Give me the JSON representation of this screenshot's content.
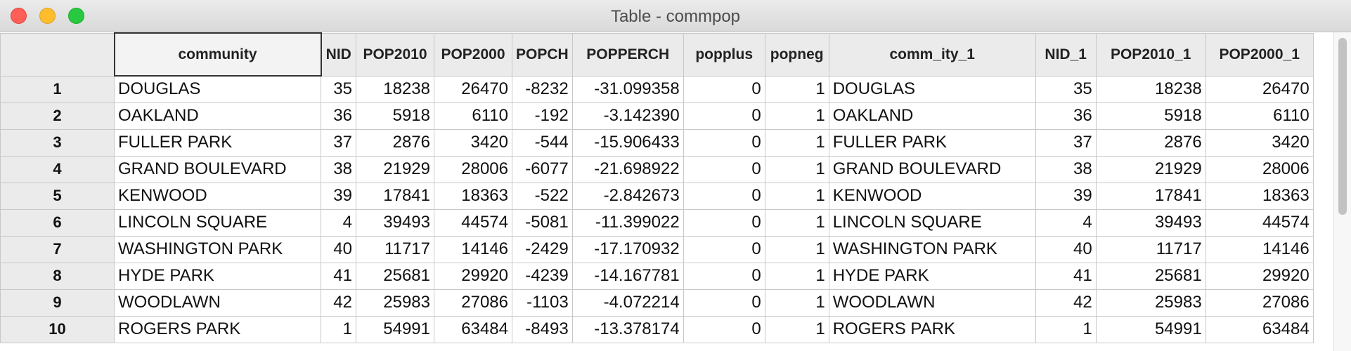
{
  "window": {
    "title": "Table - commpop"
  },
  "table": {
    "columns": [
      "",
      "community",
      "NID",
      "POP2010",
      "POP2000",
      "POPCH",
      "POPPERCH",
      "popplus",
      "popneg",
      "comm_ity_1",
      "NID_1",
      "POP2010_1",
      "POP2000_1"
    ],
    "rows": [
      [
        "1",
        "DOUGLAS",
        "35",
        "18238",
        "26470",
        "-8232",
        "-31.099358",
        "0",
        "1",
        "DOUGLAS",
        "35",
        "18238",
        "26470"
      ],
      [
        "2",
        "OAKLAND",
        "36",
        "5918",
        "6110",
        "-192",
        "-3.142390",
        "0",
        "1",
        "OAKLAND",
        "36",
        "5918",
        "6110"
      ],
      [
        "3",
        "FULLER PARK",
        "37",
        "2876",
        "3420",
        "-544",
        "-15.906433",
        "0",
        "1",
        "FULLER PARK",
        "37",
        "2876",
        "3420"
      ],
      [
        "4",
        "GRAND BOULEVARD",
        "38",
        "21929",
        "28006",
        "-6077",
        "-21.698922",
        "0",
        "1",
        "GRAND BOULEVARD",
        "38",
        "21929",
        "28006"
      ],
      [
        "5",
        "KENWOOD",
        "39",
        "17841",
        "18363",
        "-522",
        "-2.842673",
        "0",
        "1",
        "KENWOOD",
        "39",
        "17841",
        "18363"
      ],
      [
        "6",
        "LINCOLN SQUARE",
        "4",
        "39493",
        "44574",
        "-5081",
        "-11.399022",
        "0",
        "1",
        "LINCOLN SQUARE",
        "4",
        "39493",
        "44574"
      ],
      [
        "7",
        "WASHINGTON PARK",
        "40",
        "11717",
        "14146",
        "-2429",
        "-17.170932",
        "0",
        "1",
        "WASHINGTON PARK",
        "40",
        "11717",
        "14146"
      ],
      [
        "8",
        "HYDE PARK",
        "41",
        "25681",
        "29920",
        "-4239",
        "-14.167781",
        "0",
        "1",
        "HYDE PARK",
        "41",
        "25681",
        "29920"
      ],
      [
        "9",
        "WOODLAWN",
        "42",
        "25983",
        "27086",
        "-1103",
        "-4.072214",
        "0",
        "1",
        "WOODLAWN",
        "42",
        "25983",
        "27086"
      ],
      [
        "10",
        "ROGERS PARK",
        "1",
        "54991",
        "63484",
        "-8493",
        "-13.378174",
        "0",
        "1",
        "ROGERS PARK",
        "1",
        "54991",
        "63484"
      ]
    ]
  },
  "colors": {
    "close": "#ff5f57",
    "minimize": "#ffbd2e",
    "maximize": "#28c940"
  }
}
